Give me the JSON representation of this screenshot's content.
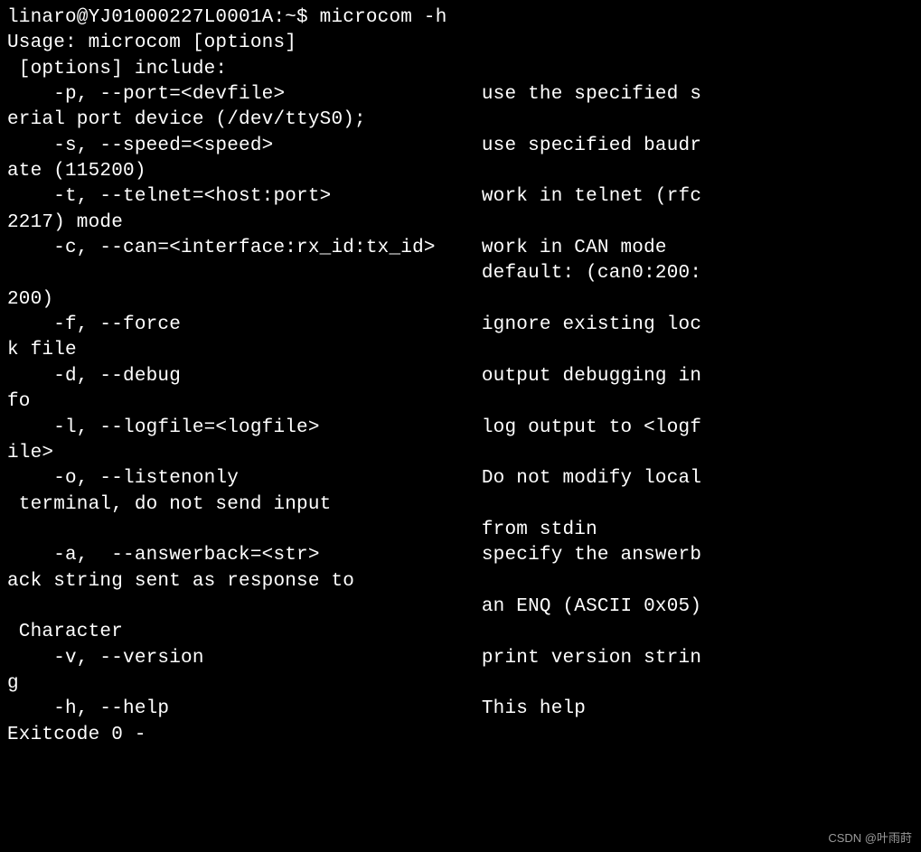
{
  "terminal": {
    "prompt": "linaro@YJ01000227L0001A:~$",
    "command": "microcom -h",
    "lines": [
      "Usage: microcom [options]",
      " [options] include:",
      "    -p, --port=<devfile>                 use the specified s",
      "erial port device (/dev/ttyS0);",
      "    -s, --speed=<speed>                  use specified baudr",
      "ate (115200)",
      "    -t, --telnet=<host:port>             work in telnet (rfc",
      "2217) mode",
      "    -c, --can=<interface:rx_id:tx_id>    work in CAN mode",
      "                                         default: (can0:200:",
      "200)",
      "    -f, --force                          ignore existing loc",
      "k file",
      "    -d, --debug                          output debugging in",
      "fo",
      "    -l, --logfile=<logfile>              log output to <logf",
      "ile>",
      "    -o, --listenonly                     Do not modify local",
      " terminal, do not send input",
      "                                         from stdin",
      "    -a,  --answerback=<str>              specify the answerb",
      "ack string sent as response to",
      "                                         an ENQ (ASCII 0x05)",
      " Character",
      "    -v, --version                        print version strin",
      "g",
      "    -h, --help                           This help",
      "Exitcode 0 -"
    ]
  },
  "watermark": "CSDN @叶雨莳"
}
